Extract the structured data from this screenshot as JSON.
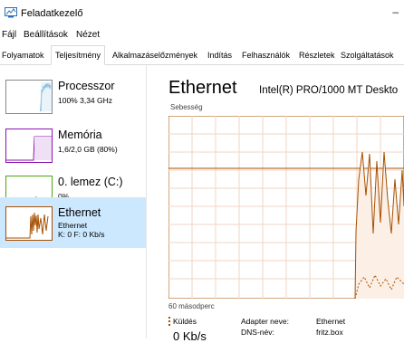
{
  "window": {
    "title": "Feladatkezelő",
    "minimize_glyph": "–"
  },
  "menu": [
    "Fájl",
    "Beállítások",
    "Nézet"
  ],
  "tabs": [
    "Folyamatok",
    "Teljesítmény",
    "Alkalmazáselőzmények",
    "Indítás",
    "Felhasználók",
    "Részletek",
    "Szolgáltatások"
  ],
  "active_tab": "Teljesítmény",
  "sidebar": [
    {
      "title": "Processzor",
      "subtitle": "100% 3,34 GHz",
      "color": "#117dbb"
    },
    {
      "title": "Memória",
      "subtitle": "1,6/2,0 GB (80%)",
      "color": "#8b12ae"
    },
    {
      "title": "0. lemez (C:)",
      "subtitle": "0%",
      "color": "#4da60c"
    },
    {
      "title": "Ethernet",
      "subtitle": "Ethernet",
      "subtitle2": "K: 0 F: 0 Kb/s",
      "color": "#a74f01"
    }
  ],
  "selected_item": "Ethernet",
  "main": {
    "title": "Ethernet",
    "adapter_name": "Intel(R) PRO/1000 MT Deskto",
    "speed_label": "Sebesség",
    "seconds_label": "60 másodperc",
    "send_label": "Küldés",
    "send_value": "0 Kb/s",
    "adapter_key": "Adapter neve:",
    "adapter_val": "Ethernet",
    "dns_key": "DNS-név:",
    "dns_val": "fritz.box"
  },
  "graph": {
    "line_color": "#a74f01",
    "grid_color": "#f1d6c0",
    "fill_color": "#fcefe5"
  }
}
